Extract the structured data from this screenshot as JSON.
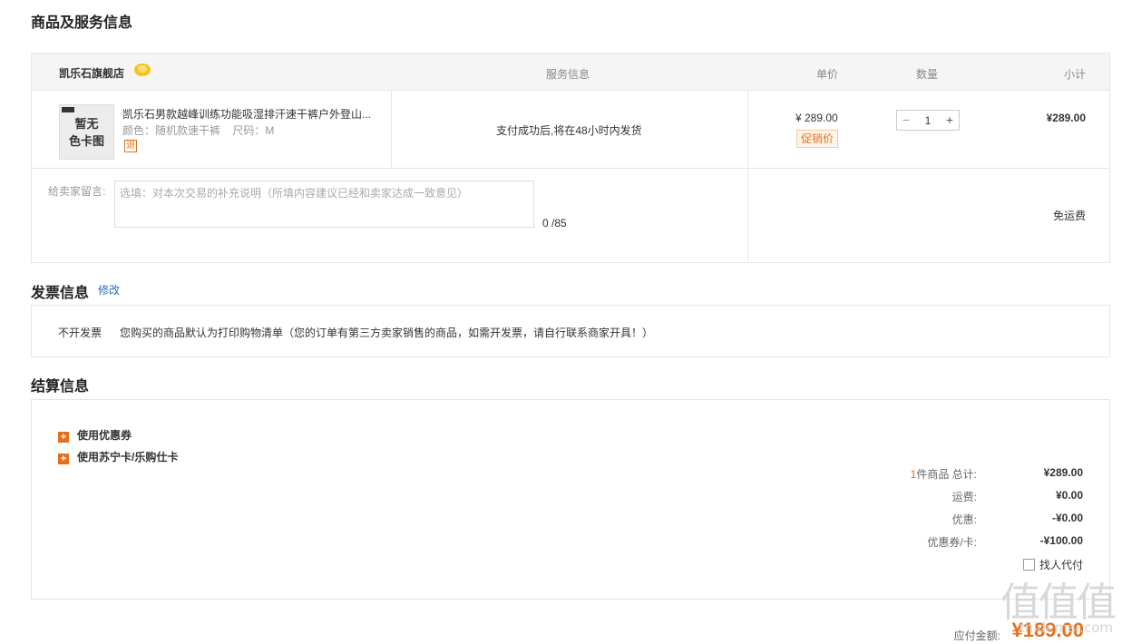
{
  "sections": {
    "products_title": "商品及服务信息",
    "invoice_title": "发票信息",
    "settlement_title": "结算信息"
  },
  "table": {
    "store_name": "凯乐石旗舰店",
    "store_badge_icon": "sun-badge-icon",
    "headers": {
      "service": "服务信息",
      "unit_price": "单价",
      "quantity": "数量",
      "subtotal": "小计"
    }
  },
  "product": {
    "thumbnail_text": "暂无\n色卡图",
    "title": "凯乐石男款越峰训练功能吸湿排汗速干裤户外登山...",
    "attributes": "颜色：随机款速干裤    尺码：M",
    "refund_badge": "退",
    "service_text": "支付成功后,将在48小时内发货",
    "unit_price": "¥ 289.00",
    "promo_tag": "促销价",
    "qty_minus": "−",
    "quantity": "1",
    "qty_plus": "+",
    "subtotal": "¥289.00"
  },
  "message": {
    "label": "给卖家留言:",
    "placeholder": "选填：对本次交易的补充说明（所填内容建议已经和卖家达成一致意见）",
    "value": "",
    "counter": "0 /85",
    "shipping": "免运费"
  },
  "invoice": {
    "edit_link": "修改",
    "type": "不开发票",
    "description": "您购买的商品默认为打印购物清单（您的订单有第三方卖家销售的商品，如需开发票，请自行联系商家开具！）"
  },
  "settlement": {
    "options": [
      {
        "label": "使用优惠券"
      },
      {
        "label": "使用苏宁卡/乐购仕卡"
      }
    ],
    "summary": {
      "count": "1",
      "count_suffix": "件商品 总计:",
      "total": "¥289.00",
      "shipping_label": "运费:",
      "shipping": "¥0.00",
      "discount_label": "优惠:",
      "discount": "-¥0.00",
      "coupon_label": "优惠券/卡:",
      "coupon": "-¥100.00"
    },
    "proxy_pay": "找人代付",
    "proxy_checked": false,
    "pay_label": "应付金额:",
    "pay_amount": "¥189.00"
  },
  "watermark": {
    "text": "值值值",
    "url": "zhidemai.com"
  },
  "colors": {
    "accent": "#e5701b",
    "link": "#2a6ebb",
    "border": "#e6e6e6",
    "header_bg": "#f5f5f5"
  }
}
